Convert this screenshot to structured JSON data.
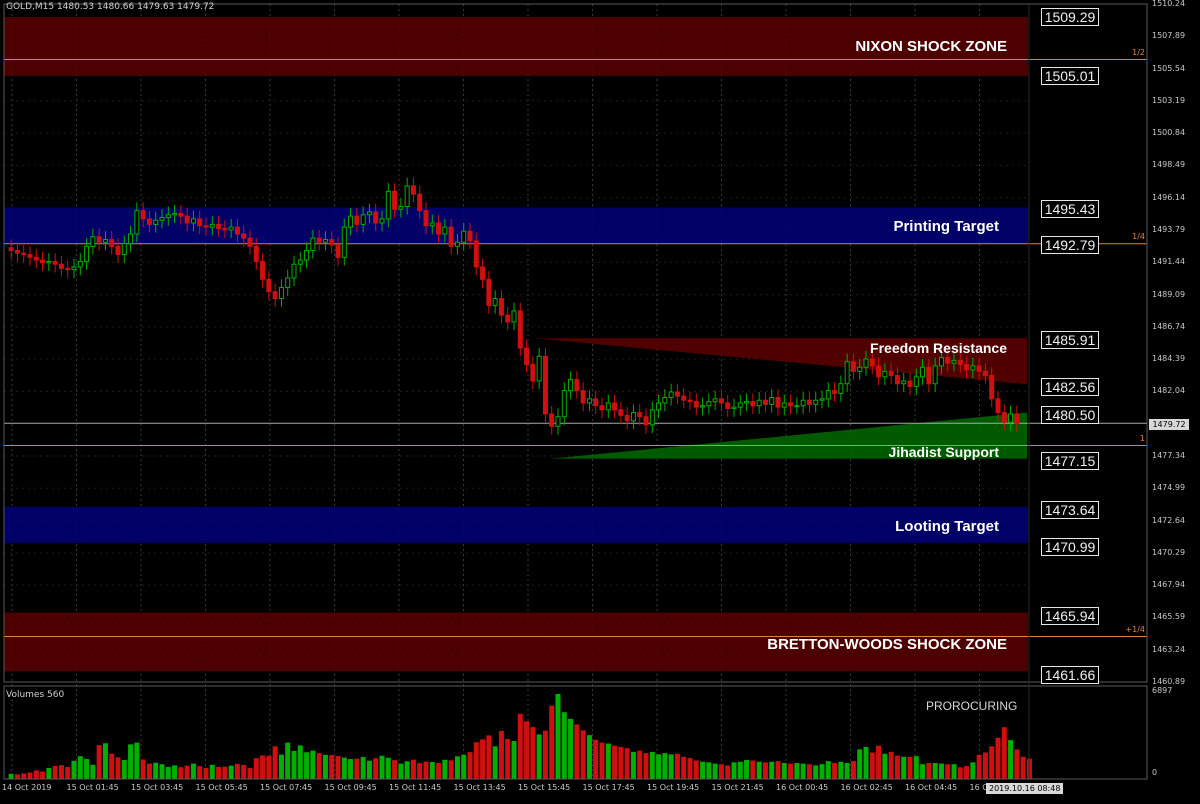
{
  "header": {
    "symbol_info": "GOLD,M15  1480.53 1480.66 1479.63 1479.72"
  },
  "zones": [
    {
      "label": "NIXON SHOCK ZONE",
      "top": 1509.29,
      "bottom": 1505.01,
      "color": "#5a0000"
    },
    {
      "label": "Printing Target",
      "top": 1495.43,
      "bottom": 1492.79,
      "color": "#000078"
    },
    {
      "label": "Looting Target",
      "top": 1473.64,
      "bottom": 1470.99,
      "color": "#000078"
    },
    {
      "label": "BRETTON-WOODS SHOCK ZONE",
      "top": 1465.94,
      "bottom": 1461.66,
      "color": "#5a0000"
    }
  ],
  "channel": {
    "resistance_label": "Freedom Resistance",
    "support_label": "Jihadist Support",
    "resistance_top": 1485.91,
    "resistance_end": 1482.56,
    "support_top": 1480.5,
    "support_start": 1477.15
  },
  "price_levels": [
    "1509.29",
    "1505.01",
    "1495.43",
    "1492.79",
    "1485.91",
    "1482.56",
    "1480.50",
    "1477.15",
    "1473.64",
    "1470.99",
    "1465.94",
    "1461.66"
  ],
  "price_axis": {
    "ticks": [
      "1510.24",
      "1507.89",
      "1505.54",
      "1503.19",
      "1500.84",
      "1498.49",
      "1496.14",
      "1493.79",
      "1491.44",
      "1489.09",
      "1486.74",
      "1484.39",
      "1482.04",
      "1477.34",
      "1474.99",
      "1472.64",
      "1470.29",
      "1467.94",
      "1465.59",
      "1463.24",
      "1460.89"
    ],
    "current_price": "1479.72"
  },
  "fib_levels": [
    {
      "label": "1/2",
      "price": 1506.2
    },
    {
      "label": "1/4",
      "price": 1492.79
    },
    {
      "label": "1",
      "price": 1478.1
    },
    {
      "label": "+1/4",
      "price": 1464.2
    }
  ],
  "time_axis": {
    "labels": [
      "14 Oct 2019",
      "15 Oct 01:45",
      "15 Oct 03:45",
      "15 Oct 05:45",
      "15 Oct 07:45",
      "15 Oct 09:45",
      "15 Oct 11:45",
      "15 Oct 13:45",
      "15 Oct 15:45",
      "15 Oct 17:45",
      "15 Oct 19:45",
      "15 Oct 21:45",
      "16 Oct 00:45",
      "16 Oct 02:45",
      "16 Oct 04:45",
      "16 Oct",
      "45"
    ],
    "current_time": "2019.10.16 08:48"
  },
  "volumes": {
    "title": "Volumes 560",
    "max_label": "6897",
    "min_label": "0",
    "indicator": "PROROCURING"
  },
  "colors": {
    "bull": "#00b000",
    "bear": "#d01010",
    "fib": "#e08040",
    "grid": "#3a3a3a"
  },
  "chart_data": {
    "type": "candlestick",
    "symbol": "GOLD",
    "timeframe": "M15",
    "ylim": [
      1460.89,
      1510.24
    ],
    "close": [
      1492.3,
      1492.1,
      1492.0,
      1491.8,
      1491.6,
      1491.4,
      1491.5,
      1491.3,
      1491.0,
      1490.9,
      1491.1,
      1491.5,
      1492.6,
      1493.3,
      1492.9,
      1493.1,
      1492.6,
      1492.0,
      1492.8,
      1493.5,
      1495.2,
      1494.6,
      1494.2,
      1494.5,
      1494.7,
      1494.9,
      1495.0,
      1494.8,
      1494.3,
      1494.6,
      1494.1,
      1494.0,
      1494.2,
      1493.9,
      1493.8,
      1494.0,
      1493.5,
      1493.2,
      1492.6,
      1491.5,
      1490.2,
      1489.3,
      1488.8,
      1489.6,
      1490.3,
      1491.3,
      1491.6,
      1492.3,
      1493.2,
      1492.9,
      1493.1,
      1492.7,
      1491.8,
      1494.0,
      1494.8,
      1494.2,
      1494.9,
      1495.1,
      1494.3,
      1494.6,
      1496.6,
      1495.3,
      1495.5,
      1497.0,
      1496.4,
      1495.2,
      1494.1,
      1494.3,
      1493.5,
      1494.0,
      1492.6,
      1492.9,
      1493.7,
      1493.0,
      1491.1,
      1490.2,
      1488.3,
      1488.8,
      1487.6,
      1487.1,
      1487.9,
      1485.2,
      1484.0,
      1482.8,
      1484.6,
      1480.4,
      1479.5,
      1480.2,
      1482.1,
      1482.9,
      1482.1,
      1481.2,
      1481.5,
      1481.0,
      1480.7,
      1481.2,
      1480.7,
      1480.3,
      1479.9,
      1480.5,
      1480.2,
      1479.6,
      1480.7,
      1481.2,
      1481.6,
      1482.0,
      1481.7,
      1481.4,
      1481.3,
      1480.9,
      1481.0,
      1481.3,
      1481.5,
      1481.2,
      1480.8,
      1480.9,
      1481.2,
      1481.3,
      1481.0,
      1481.4,
      1481.1,
      1481.6,
      1480.9,
      1481.2,
      1481.0,
      1481.0,
      1481.4,
      1481.1,
      1481.4,
      1481.5,
      1482.1,
      1481.9,
      1482.6,
      1484.2,
      1483.5,
      1483.8,
      1484.4,
      1483.9,
      1483.1,
      1483.5,
      1483.2,
      1482.6,
      1482.8,
      1482.4,
      1483.1,
      1483.8,
      1482.6,
      1483.9,
      1484.5,
      1484.1,
      1484.3,
      1484.0,
      1483.6,
      1483.9,
      1483.5,
      1483.2,
      1481.5,
      1480.5,
      1479.8,
      1480.4,
      1479.7
    ],
    "volume": [
      420,
      380,
      450,
      520,
      700,
      610,
      890,
      1050,
      1120,
      980,
      1480,
      1850,
      1620,
      1150,
      2750,
      2900,
      2050,
      1760,
      1540,
      2810,
      2950,
      1580,
      1250,
      1320,
      1200,
      980,
      1100,
      960,
      1080,
      1250,
      1040,
      900,
      1150,
      980,
      1000,
      1080,
      1230,
      1150,
      890,
      1690,
      1910,
      1880,
      2650,
      1980,
      2950,
      2280,
      2720,
      2170,
      2300,
      2100,
      1960,
      1940,
      1870,
      1740,
      1620,
      1650,
      1780,
      1480,
      1690,
      1890,
      1720,
      1530,
      1250,
      1440,
      1570,
      1290,
      1410,
      1380,
      1300,
      1560,
      1520,
      1840,
      1960,
      2180,
      2980,
      3220,
      3540,
      2650,
      3890,
      3250,
      3080,
      5280,
      4680,
      4210,
      3620,
      3920,
      5950,
      6897,
      5420,
      4870,
      4430,
      3950,
      3560,
      3180,
      2950,
      2880,
      2700,
      2600,
      2500,
      2200,
      2300,
      2100,
      2200,
      2000,
      2100,
      2000,
      2050,
      1800,
      1700,
      1500,
      1400,
      1350,
      1250,
      1200,
      1100,
      1350,
      1400,
      1550,
      1500,
      1400,
      1350,
      1400,
      1450,
      1300,
      1250,
      1300,
      1250,
      1200,
      1100,
      1200,
      1450,
      1300,
      1400,
      1300,
      1450,
      2400,
      2600,
      2150,
      2700,
      2050,
      2200,
      1900,
      1800,
      1800,
      1850,
      1200,
      1300,
      1300,
      1250,
      1200,
      1200,
      950,
      1050,
      1350,
      1950,
      2150,
      2650,
      3350,
      4200,
      3150,
      2400,
      1800,
      1650
    ]
  }
}
